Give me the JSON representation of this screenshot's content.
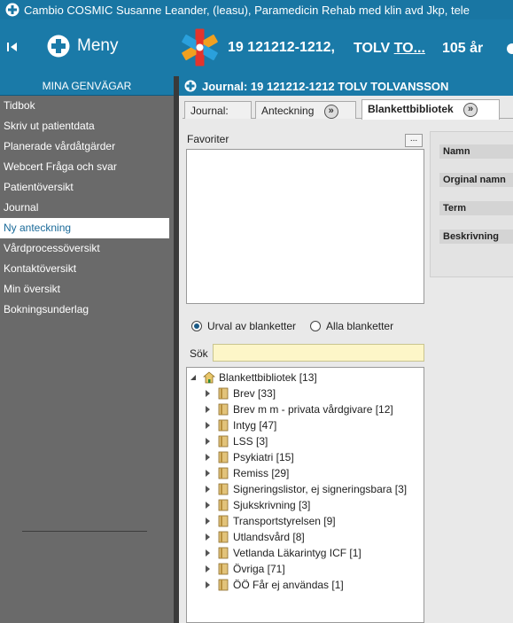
{
  "window": {
    "title": "Cambio COSMIC Susanne  Leander, (leasu), Paramedicin Rehab med klin avd Jkp, tele",
    "accent": "#1a7aa8"
  },
  "header": {
    "menu_label": "Meny",
    "patient_id": "19 121212-1212,",
    "patient_first": "TOLV",
    "patient_last": "TO...",
    "age": "105 år"
  },
  "sidebar": {
    "heading": "MINA GENVÄGAR",
    "items": [
      {
        "label": "Tidbok"
      },
      {
        "label": "Skriv ut patientdata"
      },
      {
        "label": "Planerade vårdåtgärder"
      },
      {
        "label": "Webcert Fråga och svar"
      },
      {
        "label": "Patientöversikt"
      },
      {
        "label": "Journal"
      },
      {
        "label": "Ny anteckning",
        "active": true
      },
      {
        "label": "Vårdprocessöversikt"
      },
      {
        "label": "Kontaktöversikt"
      },
      {
        "label": "Min översikt"
      },
      {
        "label": "Bokningsunderlag"
      }
    ]
  },
  "panel": {
    "title": "Journal: 19 121212-1212 TOLV TOLVANSSON",
    "tabs": [
      {
        "label": "Journal:"
      },
      {
        "label": "Anteckning"
      },
      {
        "label": "Blankettbibliotek",
        "active": true
      }
    ],
    "favorites_label": "Favoriter",
    "favorites_button": "...",
    "radio_urval": "Urval av blanketter",
    "radio_alla": "Alla blanketter",
    "search_label": "Sök",
    "search_value": ""
  },
  "tree": {
    "root": "Blankettbibliotek [13]",
    "items": [
      {
        "label": "Brev [33]"
      },
      {
        "label": "Brev m m - privata vårdgivare [12]"
      },
      {
        "label": "Intyg [47]"
      },
      {
        "label": "LSS [3]"
      },
      {
        "label": "Psykiatri [15]"
      },
      {
        "label": "Remiss [29]"
      },
      {
        "label": "Signeringslistor, ej signeringsbara [3]"
      },
      {
        "label": "Sjukskrivning [3]"
      },
      {
        "label": "Transportstyrelsen [9]"
      },
      {
        "label": "Utlandsvård [8]"
      },
      {
        "label": "Vetlanda Läkarintyg ICF [1]"
      },
      {
        "label": "Övriga [71]"
      },
      {
        "label": "ÖÖ Får ej användas [1]"
      }
    ]
  },
  "details": {
    "fields": [
      {
        "label": "Namn"
      },
      {
        "label": "Orginal namn"
      },
      {
        "label": "Term"
      },
      {
        "label": "Beskrivning"
      }
    ]
  }
}
